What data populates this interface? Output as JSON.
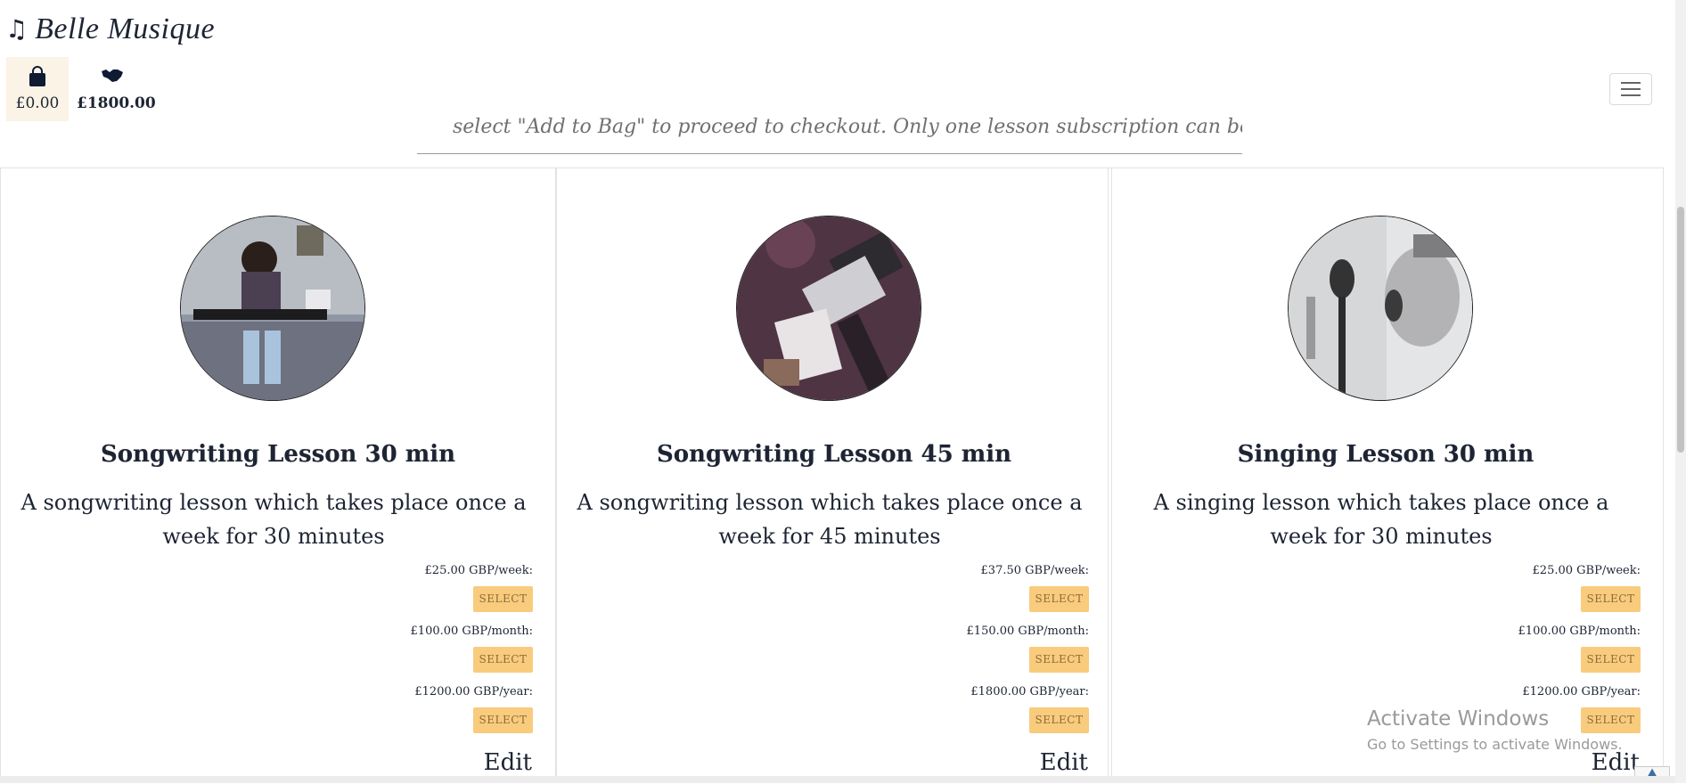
{
  "brand": {
    "name": "Belle Musique",
    "icon": "music-note-icon"
  },
  "header": {
    "bag_total": "£0.00",
    "subscription_total": "£1800.00",
    "menu_icon": "hamburger-icon"
  },
  "intro": {
    "text": "select \"Add to Bag\" to proceed to checkout. Only one lesson subscription can be processed per checkout."
  },
  "cards": [
    {
      "title": "Songwriting Lesson 30 min",
      "description": "A songwriting lesson which takes place once a week for 30 minutes",
      "prices": [
        {
          "label": "£25.00 GBP/week:",
          "button": "SELECT"
        },
        {
          "label": "£100.00 GBP/month:",
          "button": "SELECT"
        },
        {
          "label": "£1200.00 GBP/year:",
          "button": "SELECT"
        }
      ],
      "edit": "Edit"
    },
    {
      "title": "Songwriting Lesson 45 min",
      "description": "A songwriting lesson which takes place once a week for 45 minutes",
      "prices": [
        {
          "label": "£37.50 GBP/week:",
          "button": "SELECT"
        },
        {
          "label": "£150.00 GBP/month:",
          "button": "SELECT"
        },
        {
          "label": "£1800.00 GBP/year:",
          "button": "SELECT"
        }
      ],
      "edit": "Edit"
    },
    {
      "title": "Singing Lesson 30 min",
      "description": "A singing lesson which takes place once a week for 30 minutes",
      "prices": [
        {
          "label": "£25.00 GBP/week:",
          "button": "SELECT"
        },
        {
          "label": "£100.00 GBP/month:",
          "button": "SELECT"
        },
        {
          "label": "£1200.00 GBP/year:",
          "button": "SELECT"
        }
      ],
      "edit": "Edit"
    }
  ],
  "watermark": {
    "line1": "Activate Windows",
    "line2": "Go to Settings to activate Windows."
  },
  "colors": {
    "accent_button": "#f9cb7d",
    "text": "#1d2433"
  }
}
